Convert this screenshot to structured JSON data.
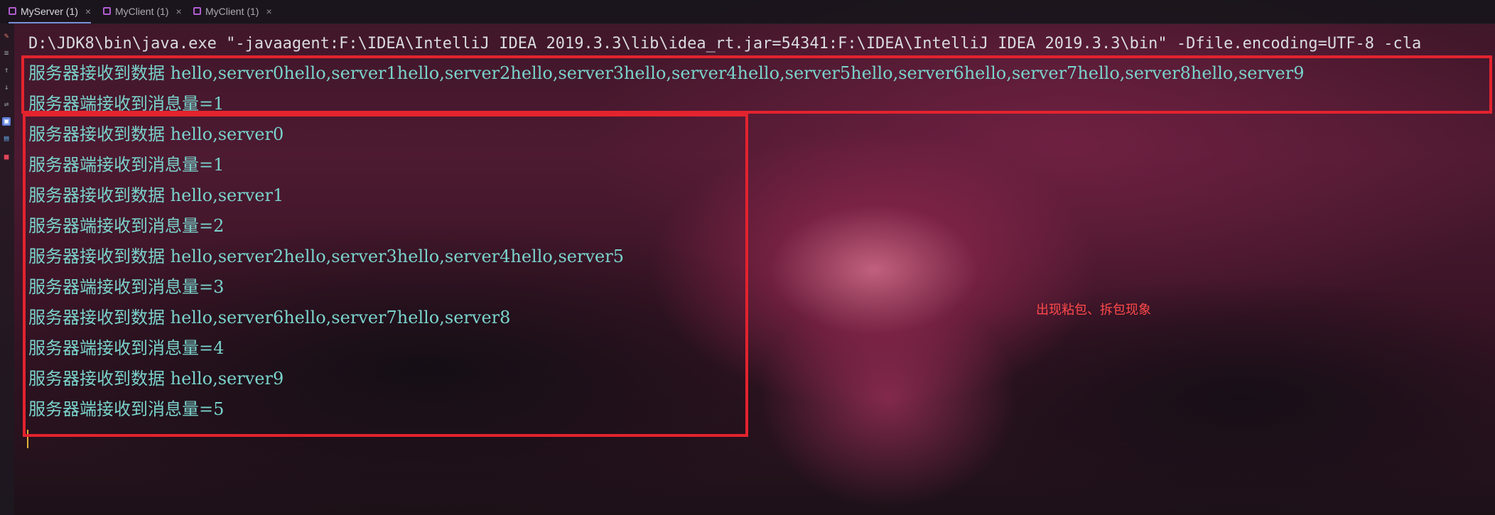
{
  "tabs": [
    {
      "label": "MyServer (1)",
      "active": true
    },
    {
      "label": "MyClient (1)",
      "active": false
    },
    {
      "label": "MyClient (1)",
      "active": false
    }
  ],
  "gutter_icons": [
    "edit-icon",
    "wrap-icon",
    "arrow-up-icon",
    "arrow-down-icon",
    "soft-wrap-icon",
    "print-icon",
    "pin-icon",
    "stop-icon"
  ],
  "console": {
    "command": "D:\\JDK8\\bin\\java.exe \"-javaagent:F:\\IDEA\\IntelliJ IDEA 2019.3.3\\lib\\idea_rt.jar=54341:F:\\IDEA\\IntelliJ IDEA 2019.3.3\\bin\" -Dfile.encoding=UTF-8 -cla",
    "lines": [
      "服务器接收到数据 hello,server0hello,server1hello,server2hello,server3hello,server4hello,server5hello,server6hello,server7hello,server8hello,server9",
      "服务器端接收到消息量=1",
      "服务器接收到数据 hello,server0",
      "服务器端接收到消息量=1",
      "服务器接收到数据 hello,server1",
      "服务器端接收到消息量=2",
      "服务器接收到数据 hello,server2hello,server3hello,server4hello,server5",
      "服务器端接收到消息量=3",
      "服务器接收到数据 hello,server6hello,server7hello,server8",
      "服务器端接收到消息量=4",
      "服务器接收到数据 hello,server9",
      "服务器端接收到消息量=5"
    ]
  },
  "annotation": "出现粘包、拆包现象",
  "colors": {
    "highlight_box": "#e3232e",
    "console_text": "#7ad3cc",
    "annotation_text": "#ff4a4a"
  }
}
